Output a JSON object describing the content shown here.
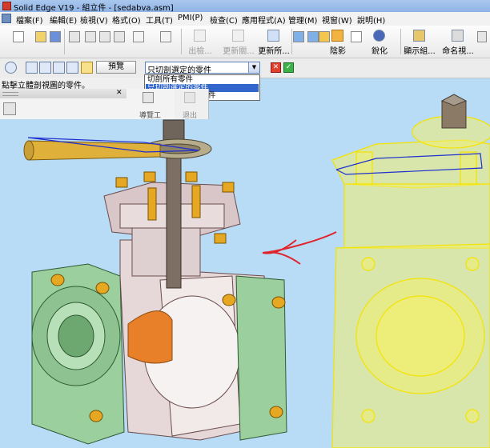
{
  "window": {
    "title": "Solid Edge V19 - 組立件 - [sedabva.asm]"
  },
  "menu": [
    {
      "label": "檔案(F)"
    },
    {
      "label": "編輯(E)"
    },
    {
      "label": "檢視(V)"
    },
    {
      "label": "格式(O)"
    },
    {
      "label": "工具(T)"
    },
    {
      "label": "PMI(P)"
    },
    {
      "label": "檢查(C)"
    },
    {
      "label": "應用程式(A)"
    },
    {
      "label": "管理(M)"
    },
    {
      "label": "視窗(W)"
    },
    {
      "label": "說明(H)"
    }
  ],
  "toolbar": {
    "buttons": [
      {
        "label": "出檢...",
        "icon": "assembly-disabled-icon",
        "enabled": false
      },
      {
        "label": "更新關...",
        "icon": "update-links-icon",
        "enabled": false
      },
      {
        "label": "更新所...",
        "icon": "update-all-icon",
        "enabled": true
      },
      {
        "label": "陰影",
        "icon": "shading-icon",
        "enabled": true
      },
      {
        "label": "銳化",
        "icon": "sharpen-icon",
        "enabled": true
      },
      {
        "label": "顯示組...",
        "icon": "show-assembly-icon",
        "enabled": true
      },
      {
        "label": "命名視...",
        "icon": "named-views-icon",
        "enabled": true
      }
    ]
  },
  "clipping_bar": {
    "preview_label": "預覽",
    "dropdown": {
      "selected": "只切剖選定的零件",
      "options": [
        "切剖所有零件",
        "只切剖選定的零件",
        "只切剖未選定的零件"
      ],
      "highlighted_index": 1
    },
    "cancel_label": "✕",
    "ok_label": "✓"
  },
  "status": {
    "prompt": "點擊立體剖視圖的零件。"
  },
  "side_panel": {
    "tab_labels": [
      "導覽工",
      "退出"
    ]
  },
  "colors": {
    "viewport_bg": "#b9dcf6",
    "body_green": "#9ccf9e",
    "body_pink": "#e6d8d8",
    "bolt_gold": "#e6a822",
    "yellow_wire": "#f6ef32",
    "annotation_red": "#e0242c"
  }
}
